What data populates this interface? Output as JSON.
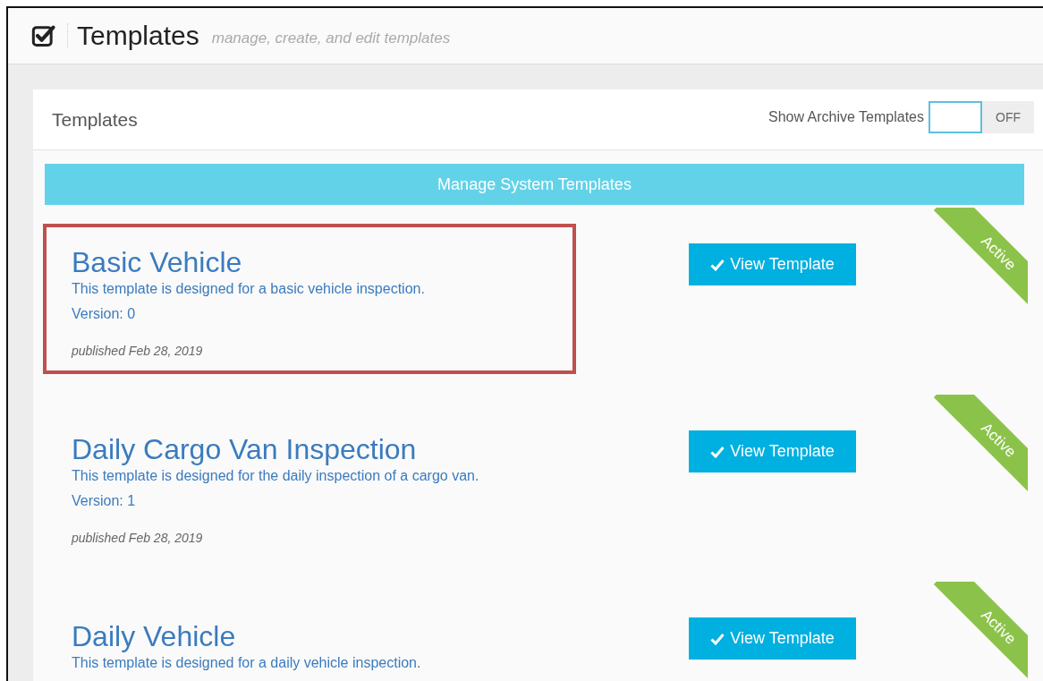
{
  "page_header": {
    "title": "Templates",
    "subtitle": "manage, create, and edit templates"
  },
  "panel": {
    "title": "Templates",
    "archive_toggle": {
      "label": "Show Archive Templates",
      "state_text": "OFF",
      "on": false
    },
    "manage_button": "Manage System Templates",
    "templates": [
      {
        "name": "Basic Vehicle",
        "description": "This template is designed for a basic vehicle inspection.",
        "version": "Version: 0",
        "published": "published Feb 28, 2019",
        "button": "View Template",
        "status": "Active",
        "highlighted": true
      },
      {
        "name": "Daily Cargo Van Inspection",
        "description": "This template is designed for the daily inspection of a cargo van.",
        "version": "Version: 1",
        "published": "published Feb 28, 2019",
        "button": "View Template",
        "status": "Active",
        "highlighted": false
      },
      {
        "name": "Daily Vehicle",
        "description": "This template is designed for a daily vehicle inspection.",
        "button": "View Template",
        "status": "Active",
        "highlighted": false
      }
    ]
  }
}
